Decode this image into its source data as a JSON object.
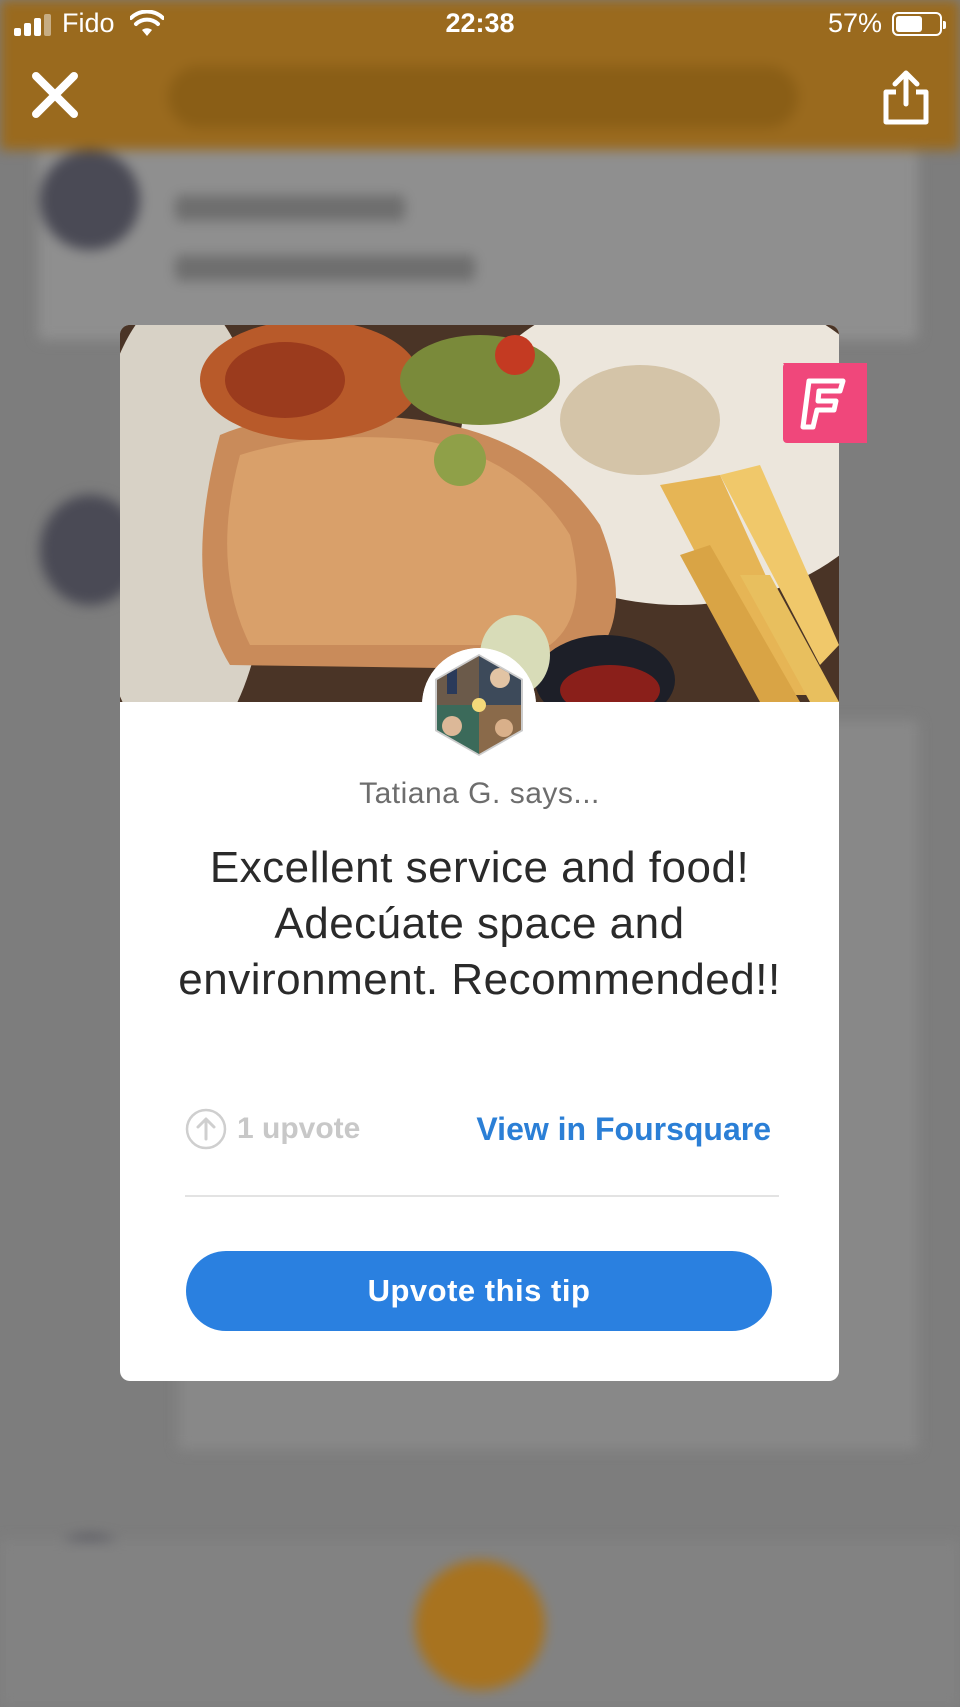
{
  "status_bar": {
    "carrier": "Fido",
    "time": "22:38",
    "battery_percent": "57%",
    "battery_level": 0.57
  },
  "header": {
    "close_icon": "close-icon",
    "share_icon": "share-icon"
  },
  "tip_modal": {
    "author_line": "Tatiana G. says...",
    "tip_text": "Excellent service and food! Adecúate space and environment. Recommended!!",
    "upvote_count": "1 upvote",
    "view_link": "View in Foursquare",
    "upvote_button": "Upvote this tip",
    "badge_icon": "foursquare-icon"
  },
  "colors": {
    "accent_blue": "#2a80e0",
    "link_blue": "#2b7fd6",
    "foursquare_pink": "#f0477b",
    "header_orange": "#9a6a1e"
  }
}
